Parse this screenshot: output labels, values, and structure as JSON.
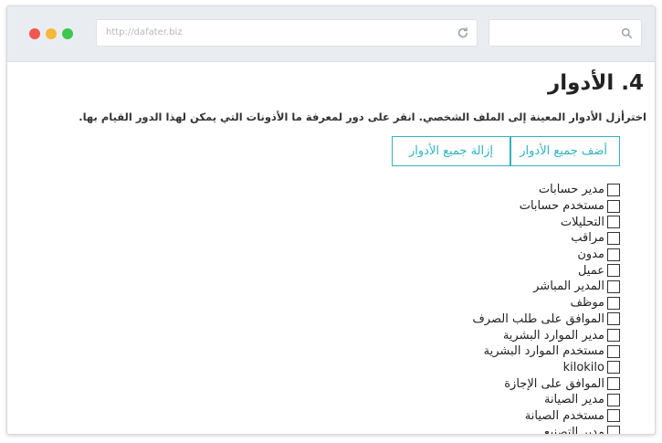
{
  "browser": {
    "url": "http://dafater.biz"
  },
  "page": {
    "title": "4. الأدوار",
    "description": "اخترأزل الأدوار المعينة إلى الملف الشخصي. انقر على دور لمعرفة ما الأذونات التي يمكن لهذا الدور القيام بها.",
    "add_all_label": "أضف جميع الأدوار",
    "remove_all_label": "إزالة جميع الأدوار"
  },
  "roles": [
    {
      "label": "مدير حسابات",
      "checked": false
    },
    {
      "label": "مستخدم حسابات",
      "checked": false
    },
    {
      "label": "التحليلات",
      "checked": false
    },
    {
      "label": "مراقب",
      "checked": false
    },
    {
      "label": "مدون",
      "checked": false
    },
    {
      "label": "عميل",
      "checked": false
    },
    {
      "label": "المدير المباشر",
      "checked": false
    },
    {
      "label": "موظف",
      "checked": false
    },
    {
      "label": "الموافق على طلب الصرف",
      "checked": false
    },
    {
      "label": "مدير الموارد البشرية",
      "checked": false
    },
    {
      "label": "مستخدم الموارد البشرية",
      "checked": false
    },
    {
      "label": "kilokilo",
      "checked": false
    },
    {
      "label": "الموافق على الإجازة",
      "checked": false
    },
    {
      "label": "مدير الصيانة",
      "checked": false
    },
    {
      "label": "مستخدم الصيانة",
      "checked": false
    },
    {
      "label": "مدير التصنيع",
      "checked": false
    }
  ],
  "colors": {
    "accent": "#2fb3c1",
    "close": "#f0584f",
    "minimize": "#f5b83a",
    "maximize": "#3fc64f"
  }
}
